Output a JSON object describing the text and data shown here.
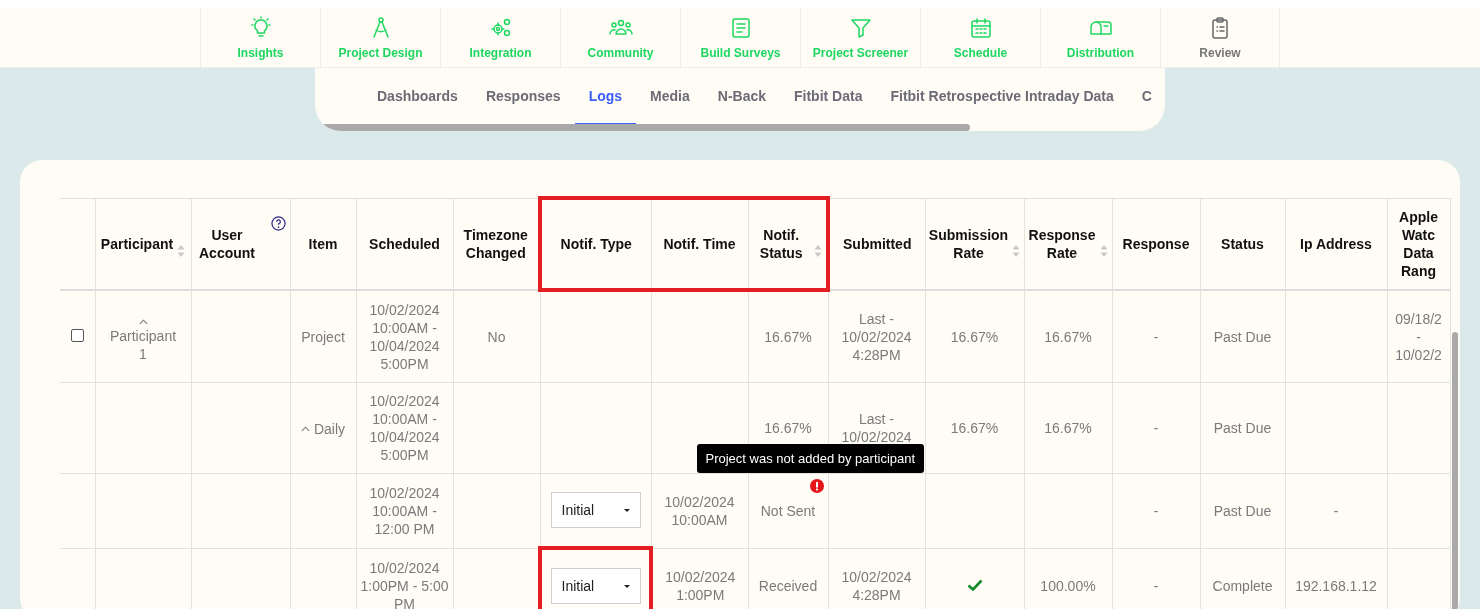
{
  "nav": [
    {
      "label": "Insights",
      "selected": false
    },
    {
      "label": "Project Design",
      "selected": false
    },
    {
      "label": "Integration",
      "selected": false
    },
    {
      "label": "Community",
      "selected": false
    },
    {
      "label": "Build Surveys",
      "selected": false
    },
    {
      "label": "Project Screener",
      "selected": false
    },
    {
      "label": "Schedule",
      "selected": false
    },
    {
      "label": "Distribution",
      "selected": false
    },
    {
      "label": "Review",
      "selected": true
    }
  ],
  "subtabs": [
    {
      "label": "Dashboards",
      "selected": false
    },
    {
      "label": "Responses",
      "selected": false
    },
    {
      "label": "Logs",
      "selected": true
    },
    {
      "label": "Media",
      "selected": false
    },
    {
      "label": "N-Back",
      "selected": false
    },
    {
      "label": "Fitbit Data",
      "selected": false
    },
    {
      "label": "Fitbit Retrospective Intraday Data",
      "selected": false
    },
    {
      "label": "C",
      "selected": false
    }
  ],
  "table": {
    "columns": [
      {
        "label": "Participant",
        "sortable": true,
        "help": false,
        "highlighted": false
      },
      {
        "label": "User Account",
        "sortable": false,
        "help": true,
        "highlighted": false
      },
      {
        "label": "Item",
        "sortable": false,
        "help": false,
        "highlighted": false
      },
      {
        "label": "Scheduled",
        "sortable": false,
        "help": false,
        "highlighted": false
      },
      {
        "label": "Timezone Changed",
        "sortable": false,
        "help": false,
        "highlighted": false
      },
      {
        "label": "Notif. Type",
        "sortable": false,
        "help": false,
        "highlighted": true
      },
      {
        "label": "Notif. Time",
        "sortable": false,
        "help": false,
        "highlighted": true
      },
      {
        "label": "Notif. Status",
        "sortable": true,
        "help": false,
        "highlighted": true
      },
      {
        "label": "Submitted",
        "sortable": false,
        "help": false,
        "highlighted": false
      },
      {
        "label": "Submission Rate",
        "sortable": true,
        "help": false,
        "highlighted": false
      },
      {
        "label": "Response Rate",
        "sortable": true,
        "help": false,
        "highlighted": false
      },
      {
        "label": "Response",
        "sortable": false,
        "help": false,
        "highlighted": false
      },
      {
        "label": "Status",
        "sortable": false,
        "help": false,
        "highlighted": false
      },
      {
        "label": "Ip Address",
        "sortable": false,
        "help": false,
        "highlighted": false
      },
      {
        "label": "Apple Watc Data Rang",
        "sortable": false,
        "help": false,
        "highlighted": false
      }
    ],
    "rows": [
      {
        "checkbox": {
          "checked": false
        },
        "cells": [
          {
            "kind": "toggle-stacked",
            "text": "Participant 1",
            "expanded": true
          },
          {
            "kind": "empty"
          },
          {
            "kind": "text",
            "text": "Project"
          },
          {
            "kind": "text",
            "text": "10/02/2024 10:00AM - 10/04/2024 5:00PM"
          },
          {
            "kind": "text",
            "text": "No"
          },
          {
            "kind": "empty"
          },
          {
            "kind": "empty"
          },
          {
            "kind": "text",
            "text": "16.67%"
          },
          {
            "kind": "text",
            "text": "Last - 10/02/2024 4:28PM"
          },
          {
            "kind": "text",
            "text": "16.67%"
          },
          {
            "kind": "text",
            "text": "16.67%"
          },
          {
            "kind": "text",
            "text": "-"
          },
          {
            "kind": "text",
            "text": "Past Due"
          },
          {
            "kind": "empty"
          },
          {
            "kind": "text",
            "text": "09/18/2 - 10/02/2"
          }
        ]
      },
      {
        "cells": [
          {
            "kind": "empty"
          },
          {
            "kind": "empty"
          },
          {
            "kind": "toggle",
            "text": "Daily",
            "expanded": true
          },
          {
            "kind": "text",
            "text": "10/02/2024 10:00AM - 10/04/2024 5:00PM"
          },
          {
            "kind": "empty"
          },
          {
            "kind": "empty"
          },
          {
            "kind": "empty"
          },
          {
            "kind": "text",
            "text": "16.67%"
          },
          {
            "kind": "text",
            "text": "Last - 10/02/2024"
          },
          {
            "kind": "text",
            "text": "16.67%"
          },
          {
            "kind": "text",
            "text": "16.67%"
          },
          {
            "kind": "text",
            "text": "-"
          },
          {
            "kind": "text",
            "text": "Past Due"
          },
          {
            "kind": "empty"
          },
          {
            "kind": "empty"
          }
        ]
      },
      {
        "cells": [
          {
            "kind": "empty"
          },
          {
            "kind": "empty"
          },
          {
            "kind": "empty"
          },
          {
            "kind": "text",
            "text": "10/02/2024 10:00AM - 12:00 PM"
          },
          {
            "kind": "empty"
          },
          {
            "kind": "select",
            "value": "Initial",
            "highlighted": false
          },
          {
            "kind": "text",
            "text": "10/02/2024 10:00AM"
          },
          {
            "kind": "alert",
            "text": "Not Sent",
            "tooltip": "Project was not added by participant"
          },
          {
            "kind": "empty"
          },
          {
            "kind": "empty"
          },
          {
            "kind": "empty"
          },
          {
            "kind": "text",
            "text": "-"
          },
          {
            "kind": "text",
            "text": "Past Due"
          },
          {
            "kind": "text",
            "text": "-"
          },
          {
            "kind": "empty"
          }
        ]
      },
      {
        "cells": [
          {
            "kind": "empty"
          },
          {
            "kind": "empty"
          },
          {
            "kind": "empty"
          },
          {
            "kind": "text",
            "text": "10/02/2024 1:00PM - 5:00 PM"
          },
          {
            "kind": "empty"
          },
          {
            "kind": "select",
            "value": "Initial",
            "highlighted": true
          },
          {
            "kind": "text",
            "text": "10/02/2024 1:00PM"
          },
          {
            "kind": "text",
            "text": "Received"
          },
          {
            "kind": "text",
            "text": "10/02/2024 4:28PM"
          },
          {
            "kind": "check"
          },
          {
            "kind": "text",
            "text": "100.00%"
          },
          {
            "kind": "text",
            "text": "-"
          },
          {
            "kind": "text",
            "text": "Complete"
          },
          {
            "kind": "text",
            "text": "192.168.1.12"
          },
          {
            "kind": "empty"
          }
        ]
      }
    ]
  }
}
